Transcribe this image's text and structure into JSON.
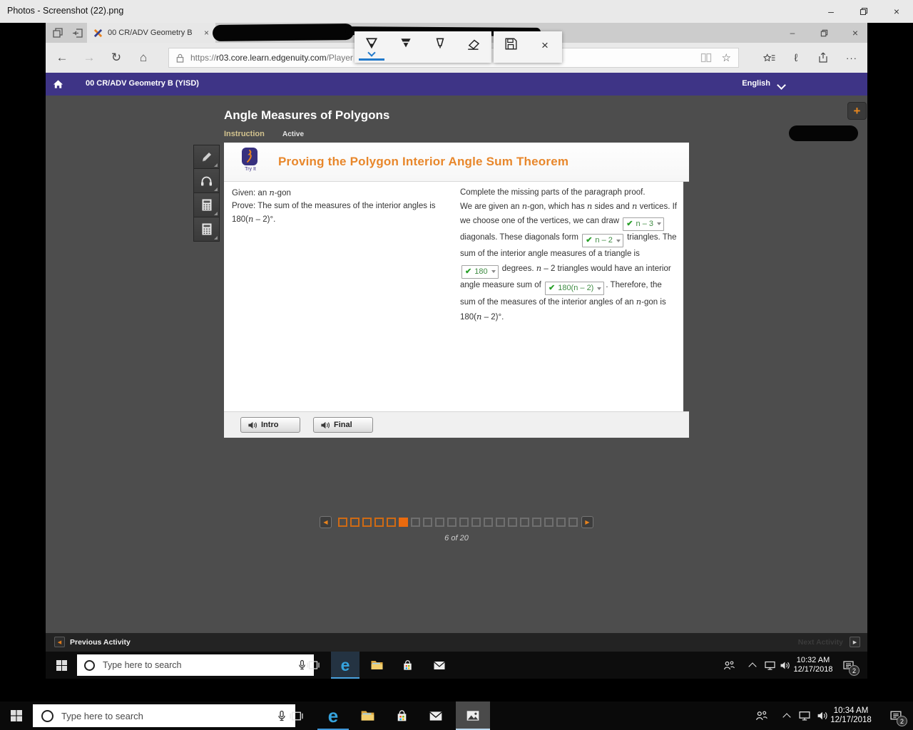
{
  "icons": {
    "minimize": "–",
    "close": "×",
    "back": "←",
    "forward": "→",
    "refresh": "↻",
    "home_glyph": "⌂",
    "star": "☆",
    "ink": "ℓ",
    "more": "···",
    "plus": "+",
    "left_arrow": "◀",
    "right_arrow": "▶",
    "check": "✔"
  },
  "photos": {
    "title": "Photos - Screenshot (22).png"
  },
  "edge": {
    "tab_title": "00 CR/ADV Geometry B",
    "url_scheme": "https://",
    "url_domain": "r03.core.learn.edgenuity.com",
    "url_path": "/Player"
  },
  "lms": {
    "course": "00 CR/ADV Geometry B (YISD)",
    "language": "English",
    "page_title": "Angle Measures of Polygons",
    "tab_instruction": "Instruction",
    "tab_active": "Active",
    "panel": {
      "badge": "Try It",
      "title": "Proving the Polygon Interior Angle Sum Theorem",
      "given_runs": [
        {
          "t": "Given: an "
        },
        {
          "i": "n"
        },
        {
          "t": "-gon"
        }
      ],
      "prove_runs": [
        {
          "t": "Prove: The sum of the measures of the interior angles is 180("
        },
        {
          "i": "n"
        },
        {
          "t": " – 2)°."
        }
      ],
      "proof_intro": "Complete the missing parts of the paragraph proof.",
      "proof_runs": [
        {
          "t": "We are given an "
        },
        {
          "i": "n"
        },
        {
          "t": "-gon, which has "
        },
        {
          "i": "n"
        },
        {
          "t": " sides and "
        },
        {
          "i": "n"
        },
        {
          "t": " vertices. If we choose one of the vertices, we can draw "
        },
        {
          "dd": "n – 3"
        },
        {
          "t": " diagonals. These diagonals form "
        },
        {
          "dd": "n – 2"
        },
        {
          "t": " triangles. The sum of the interior angle measures of a triangle is "
        },
        {
          "dd": "180"
        },
        {
          "t": " degrees.  "
        },
        {
          "i": "n"
        },
        {
          "t": " – 2 triangles would have an interior angle measure sum of "
        },
        {
          "dd": "180(n – 2)"
        },
        {
          "t": ". Therefore, the sum of the measures of the interior angles of an "
        },
        {
          "i": "n"
        },
        {
          "t": "-gon is 180("
        },
        {
          "i": "n"
        },
        {
          "t": " – 2)°."
        }
      ],
      "intro_label": "Intro",
      "final_label": "Final"
    },
    "pagination": {
      "squares": [
        "done",
        "done",
        "done",
        "done",
        "done",
        "current",
        "todo",
        "todo",
        "todo",
        "todo",
        "todo",
        "todo",
        "todo",
        "todo",
        "todo",
        "todo",
        "todo",
        "todo",
        "todo",
        "todo"
      ],
      "label": "6 of 20"
    },
    "footer": {
      "previous": "Previous Activity",
      "next": "Next Activity"
    }
  },
  "inner_taskbar": {
    "search": "Type here to search",
    "time": "10:32 AM",
    "date": "12/17/2018",
    "badge": "2"
  },
  "outer_taskbar": {
    "search": "Type here to search",
    "time": "10:34 AM",
    "date": "12/17/2018",
    "badge": "2"
  }
}
